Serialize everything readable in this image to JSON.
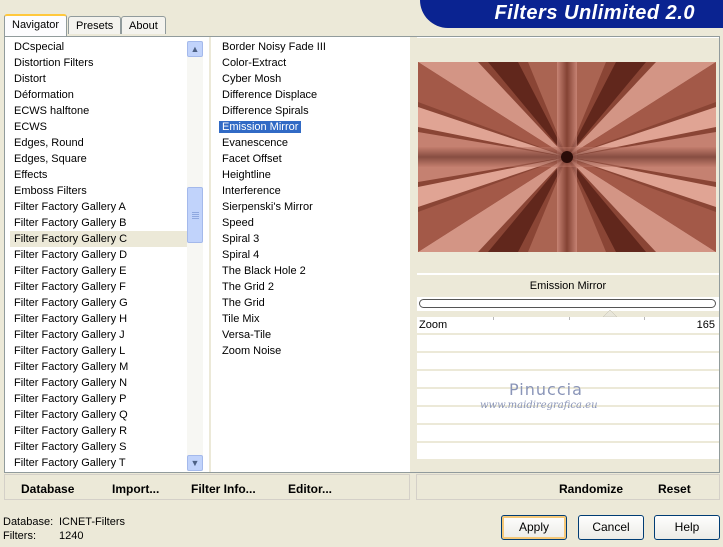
{
  "tabs": [
    "Navigator",
    "Presets",
    "About"
  ],
  "app_title": "Filters Unlimited 2.0",
  "categories": [
    "DCspecial",
    "Distortion Filters",
    "Distort",
    "Déformation",
    "ECWS halftone",
    "ECWS",
    "Edges, Round",
    "Edges, Square",
    "Effects",
    "Emboss Filters",
    "Filter Factory Gallery A",
    "Filter Factory Gallery B",
    "Filter Factory Gallery C",
    "Filter Factory Gallery D",
    "Filter Factory Gallery E",
    "Filter Factory Gallery F",
    "Filter Factory Gallery G",
    "Filter Factory Gallery H",
    "Filter Factory Gallery J",
    "Filter Factory Gallery L",
    "Filter Factory Gallery M",
    "Filter Factory Gallery N",
    "Filter Factory Gallery P",
    "Filter Factory Gallery Q",
    "Filter Factory Gallery R",
    "Filter Factory Gallery S",
    "Filter Factory Gallery T"
  ],
  "selected_category": "Filter Factory Gallery C",
  "filters": [
    "Border Noisy Fade III",
    "Color-Extract",
    "Cyber Mosh",
    "Difference Displace",
    "Difference Spirals",
    "Emission Mirror",
    "Evanescence",
    "Facet Offset",
    "Heightline",
    "Interference",
    "Sierpenski's Mirror",
    "Speed",
    "Spiral 3",
    "Spiral 4",
    "The Black Hole 2",
    "The Grid 2",
    "The Grid",
    "Tile Mix",
    "Versa-Tile",
    "Zoom Noise"
  ],
  "selected_filter": "Emission Mirror",
  "preview": {
    "filter_name": "Emission Mirror"
  },
  "params": [
    {
      "label": "Zoom",
      "value": "165"
    }
  ],
  "watermark": {
    "line1": "Pinuccia",
    "line2": "www.maidiregrafica.eu"
  },
  "toolbar_left": [
    "Database",
    "Import...",
    "Filter Info...",
    "Editor..."
  ],
  "toolbar_right": [
    "Randomize",
    "Reset"
  ],
  "footer": {
    "database_label": "Database:",
    "database_value": "ICNET-Filters",
    "filters_label": "Filters:",
    "filters_value": "1240"
  },
  "buttons": {
    "apply": "Apply",
    "cancel": "Cancel",
    "help": "Help"
  },
  "colors": {
    "banner": "#0a2391",
    "selection": "#316ac5",
    "background": "#ece9d8"
  },
  "icons": {
    "scroll_up": "chevron-up-icon",
    "scroll_down": "chevron-down-icon"
  }
}
